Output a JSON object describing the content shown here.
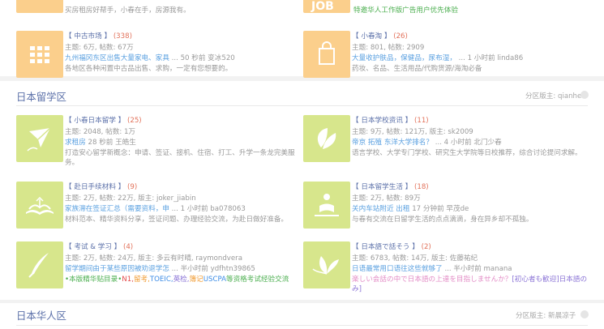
{
  "top": {
    "left_desc": "买房租房好帮手，小春在手，房源我有。",
    "right_desc": "特邀华人工作版广告用户优先体验",
    "right_badge": "JOB"
  },
  "section1": {
    "forums": [
      {
        "open": "【",
        "name": "中古市场",
        "close": "】",
        "count": "(338)",
        "line1": "主题: 6万, 帖数: 67万",
        "link": "九州福冈东区出售大量家电、家具",
        "last": " ... 50 秒前 变冰520",
        "desc": "各地区各种闲置中古品出售、求购，一定有您想要的。"
      },
      {
        "open": "【",
        "name": "小春淘",
        "close": "】",
        "count": "(26)",
        "line1": "主题: 801, 帖数: 2909",
        "link": "大量收护肤品，保健品，尿布湿，",
        "last": " ... 1 小时前 linda86",
        "desc": "药妆、名品、生活用品/代购货源/海淘必备"
      }
    ]
  },
  "section2": {
    "title": "日本留学区",
    "moderator": "分区版主: qianhe",
    "forums": [
      {
        "open": "【",
        "name": "小春日本留学",
        "close": "】",
        "count": "(25)",
        "line1": "主题: 2048, 帖数: 1万",
        "link": "求租房",
        "last": " 28 秒前 王皓生",
        "desc": "打造安心留学新概念：申请、签证、接机、住宿、打工、升学一条龙完美服",
        "desc2": "务。"
      },
      {
        "open": "【",
        "name": "日本学校资讯",
        "close": "】",
        "count": "(11)",
        "line1": "主题: 9万, 帖数: 121万, 版主: sk2009",
        "link": "帝京 拓殖 东洋大学排名？",
        "last": " ... 4 小时前 北门少春",
        "desc": "语言学校、大学专门学校、研究生大学院等日校推荐，综合讨论提问求解。"
      },
      {
        "open": "【",
        "name": "赴日手续材料",
        "close": "】",
        "count": "(9)",
        "line1": "主题: 2万, 帖数: 22万, 版主: joker_jiabin",
        "link": "家族滞在签证汇总（需要资料，申",
        "last": " ... 1 小时前 ba078063",
        "desc": "材料范本、精华资料分享，签证问题、办理经验交流，为赴日做好准备。"
      },
      {
        "open": "【",
        "name": "日本留学生活",
        "close": "】",
        "count": "(18)",
        "line1": "主题: 2万, 帖数: 89万",
        "link": "关内车站附近 出租",
        "last": " 17 分钟前 早茂de",
        "desc": "与春有交流在日留学生活的点点滴滴，身在异乡却不孤独。"
      },
      {
        "open": "【",
        "name": "考试 & 学习",
        "close": "】",
        "count": "(4)",
        "line1": "主题: 2万, 帖数: 24万, 版主: 多云有时晴, raymondvera",
        "link": "留学期间由于某些原因被劝退学怎",
        "last": " ... 半小时前 ydfhtn39865",
        "desc_parts": [
          {
            "t": "•本版精华贴目录•",
            "c": "hl"
          },
          {
            "t": "N1,",
            "c": "rd"
          },
          {
            "t": "留考,",
            "c": "or"
          },
          {
            "t": "TOEIC,",
            "c": "bl"
          },
          {
            "t": "英检,",
            "c": "pl"
          },
          {
            "t": "簿记",
            "c": "or"
          },
          {
            "t": "USCPA",
            "c": "bl"
          },
          {
            "t": "等资格考试经验交流",
            "c": "hl"
          }
        ]
      },
      {
        "open": "【",
        "name": "日本語で話そう",
        "close": "】",
        "count": "(2)",
        "line1": "主题: 6783, 帖数: 14万, 版主: 佐藤祐纪",
        "link": "日语最常用口语往这些就够了",
        "last": " ... 半小时前 manana",
        "desc_parts": [
          {
            "t": "楽しい会話の中で日本語の上達を目指しませんか？",
            "c": "pk"
          },
          {
            "t": "[初心者も歓迎]日本語の",
            "c": "pl"
          }
        ],
        "desc2": "み]"
      }
    ]
  },
  "section3": {
    "title": "日本华人区",
    "moderator": "分区版主: 新晨凉子"
  },
  "icons": {
    "market": "grid-icon",
    "shop": "shopping-bag-icon",
    "study": "paper-plane-icon",
    "school": "leaf-icon",
    "docs": "open-book-icon",
    "life": "reading-person-icon",
    "exam": "quill-pen-icon",
    "japanese": "flower-icon"
  },
  "colors": {
    "orange_tile": "#fbcf8c",
    "green_tile": "#d7e68c",
    "link": "#5aa0e0",
    "forum_name": "#5a6fa8",
    "count": "#e2725b"
  }
}
